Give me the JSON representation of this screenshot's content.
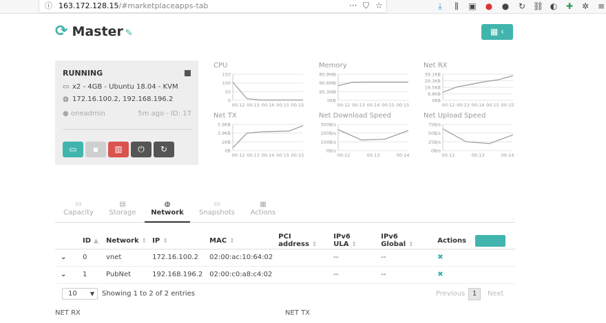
{
  "browser": {
    "host": "163.172.128.15",
    "path": "/#marketplaceapps-tab"
  },
  "header": {
    "title": "Master"
  },
  "vm": {
    "state": "RUNNING",
    "spec": "x2 - 4GB - Ubuntu 18.04 - KVM",
    "ips": "172.16.100.2, 192.168.196.2",
    "owner": "oneadmin",
    "meta": "5m ago - ID: 17",
    "action_colors": {
      "vnc": "#41b5ad",
      "save": "#cfcfcf",
      "delete": "#d9534f",
      "power": "#555555",
      "reboot": "#555555"
    }
  },
  "charts": [
    {
      "title": "CPU",
      "y_ticks": [
        "150",
        "100",
        "50",
        "0"
      ],
      "x_ticks": [
        "00:12",
        "00:13",
        "00:14",
        "00:15",
        "00:15"
      ],
      "ylim": [
        0,
        150
      ],
      "values": [
        105,
        10,
        2,
        2,
        2,
        2
      ]
    },
    {
      "title": "Memory",
      "y_ticks": [
        "585.9MB",
        "390.6MB",
        "195.3MB",
        "0KB"
      ],
      "x_ticks": [
        "00:12",
        "00:13",
        "00:14",
        "00:15",
        "00:15"
      ],
      "ylim": [
        0,
        585.9
      ],
      "values": [
        330,
        405,
        410,
        410,
        410,
        410
      ]
    },
    {
      "title": "Net RX",
      "y_ticks": [
        "39.1KB",
        "29.3KB",
        "19.5KB",
        "9.8KB",
        "0KB"
      ],
      "x_ticks": [
        "00:12",
        "00:13",
        "00:14",
        "00:15",
        "00:15"
      ],
      "ylim": [
        0,
        39.1
      ],
      "values": [
        12,
        20,
        24,
        28,
        31,
        37
      ]
    },
    {
      "title": "Net TX",
      "y_ticks": [
        "5.9KB",
        "3.9KB",
        "2KB",
        "0B"
      ],
      "x_ticks": [
        "00:12",
        "00:13",
        "00:14",
        "00:15",
        "00:15"
      ],
      "ylim": [
        0,
        5.9
      ],
      "values": [
        0.6,
        3.9,
        4.2,
        4.3,
        4.4,
        5.6
      ]
    },
    {
      "title": "Net Download Speed",
      "y_ticks": [
        "300B/s",
        "200B/s",
        "100B/s",
        "0B/s"
      ],
      "x_ticks": [
        "00:12",
        "00:13",
        "00:14"
      ],
      "ylim": [
        0,
        300
      ],
      "values": [
        240,
        120,
        130,
        230
      ]
    },
    {
      "title": "Net Upload Speed",
      "y_ticks": [
        "75B/s",
        "50B/s",
        "25B/s",
        "0B/s"
      ],
      "x_ticks": [
        "00:12",
        "00:13",
        "00:14"
      ],
      "ylim": [
        0,
        75
      ],
      "values": [
        62,
        25,
        20,
        45
      ]
    }
  ],
  "tabs": [
    {
      "label": "Capacity",
      "icon": "monitor-icon"
    },
    {
      "label": "Storage",
      "icon": "disk-icon"
    },
    {
      "label": "Network",
      "icon": "globe-icon",
      "active": true
    },
    {
      "label": "Snapshots",
      "icon": "monitor-icon"
    },
    {
      "label": "Actions",
      "icon": "calendar-icon"
    }
  ],
  "table": {
    "columns": [
      "ID",
      "Network",
      "IP",
      "MAC",
      "PCI address",
      "IPv6 ULA",
      "IPv6 Global",
      "Actions"
    ],
    "rows": [
      {
        "id": "0",
        "network": "vnet",
        "ip": "172.16.100.2",
        "mac": "02:00:ac:10:64:02",
        "pci": "",
        "ula": "--",
        "global": "--"
      },
      {
        "id": "1",
        "network": "PubNet",
        "ip": "192.168.196.2",
        "mac": "02:00:c0:a8:c4:02",
        "pci": "",
        "ula": "--",
        "global": "--"
      }
    ]
  },
  "pager": {
    "page_size": "10",
    "info": "Showing 1 to 2 of 2 entries",
    "previous": "Previous",
    "page": "1",
    "next": "Next"
  },
  "bottom": {
    "left": "NET RX",
    "right": "NET TX"
  }
}
